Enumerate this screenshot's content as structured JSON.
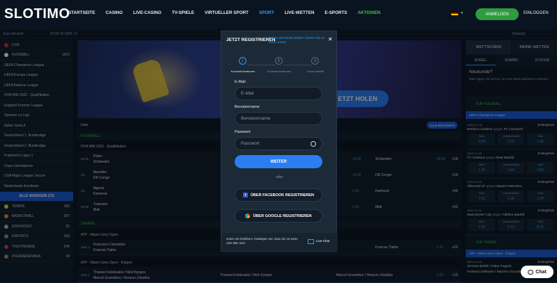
{
  "header": {
    "logo": "SLOTIMO",
    "nav": [
      "STARTSEITE",
      "CASINO",
      "LIVE-CASINO",
      "TV-SPIELE",
      "VIRTUELLER SPORT",
      "SPORT",
      "LIVE-WETTEN",
      "E-SPORTS",
      "AKTIONEN"
    ],
    "active_nav": "SPORT",
    "login": "ANMELDEN",
    "register": "EINLOGGEN"
  },
  "subbar": {
    "odds_view": "Euro-Ansicht",
    "time": "22:06:15 GMT +2",
    "format": "Dezimal"
  },
  "sidebar": {
    "items": [
      {
        "label": "LIVE",
        "count": ""
      },
      {
        "label": "FUSSBALL",
        "count": "1622"
      },
      {
        "label": "UEFA Champions League",
        "count": ""
      },
      {
        "label": "UEFA Europa League",
        "count": ""
      },
      {
        "label": "UEFA Nations League",
        "count": ""
      },
      {
        "label": "FIFA WM 2022 - Qualifikation",
        "count": ""
      },
      {
        "label": "England Premier League",
        "count": ""
      },
      {
        "label": "Spanien La Liga",
        "count": ""
      },
      {
        "label": "Italien Serie A",
        "count": ""
      },
      {
        "label": "Deutschland 1. Bundesliga",
        "count": ""
      },
      {
        "label": "Deutschland 2. Bundesliga",
        "count": ""
      },
      {
        "label": "Frankreich Ligue 1",
        "count": ""
      },
      {
        "label": "Copa Libertadores",
        "count": ""
      },
      {
        "label": "USA Major League Soccer",
        "count": ""
      },
      {
        "label": "Niederlande Eredivisie",
        "count": ""
      }
    ],
    "show_all": "ALLE ANZEIGEN (72)",
    "sports": [
      {
        "label": "TENNIS",
        "count": "165"
      },
      {
        "label": "BASKETBALL",
        "count": "207"
      },
      {
        "label": "EISHOCKEY",
        "count": "62"
      },
      {
        "label": "ESPORTS",
        "count": "159"
      },
      {
        "label": "TISCHTENNIS",
        "count": "245"
      },
      {
        "label": "PFERDERENNEN",
        "count": "42"
      }
    ]
  },
  "main": {
    "hero_button": "ETZT HOLEN",
    "live_label": "Live",
    "all_events": "ALLE 86 EVENTS",
    "football_header": "FUSSBALL",
    "football_league": "FIFA WM 2022 - Qualifikation",
    "football_matches": [
      {
        "min": "88:46",
        "t1": "Polen",
        "t2": "Schweden",
        "mid_name": "",
        "mid_odd": "",
        "odd1": "10.00",
        "right_name": "Schweden",
        "odd2": "50.00",
        "more": "+18"
      },
      {
        "min": "HZ",
        "t1": "Marokko",
        "t2": "DR Congo",
        "mid_name": "",
        "mid_odd": "",
        "odd1": "10.00",
        "right_name": "DR Congo",
        "odd2": "",
        "more": "+19"
      },
      {
        "min": "HZ",
        "t1": "Algeria",
        "t2": "Kamerun",
        "mid_name": "",
        "mid_odd": "2.80",
        "odd1": "",
        "right_name": "Kamerun",
        "odd2": "",
        "more": "+46"
      },
      {
        "min": "45:00",
        "t1": "Tunesien",
        "t2": "Mali",
        "mid_name": "",
        "mid_odd": "2.60",
        "odd1": "",
        "right_name": "Mali",
        "odd2": "",
        "more": "+52"
      }
    ],
    "tennis_header": "TENNIS",
    "tennis_league_1": "ATP - Miami Sony Open",
    "tennis_match_1": {
      "min": "Satz 3",
      "t1": "Francisco Cerundolo",
      "t2": "Frances Tiafoe",
      "right_name": "Frances Tiafoe",
      "odd": "1.25",
      "more": "+20"
    },
    "tennis_league_2": "ATP - Miami Sony Open - Doppel",
    "tennis_match_2": {
      "min": "Satz 1",
      "t1": "Thanasi Kokkinakis / Nick Kyrgios",
      "t2": "Marcel Granollers / Horacio Zeballos",
      "mid_name": "Thanasi Kokkinakis / Nick Kyrgios",
      "right_name": "Marcel Granollers / Horacio Zeballos",
      "odd": "1.65",
      "more": "+10"
    }
  },
  "modal": {
    "title": "JETZT REGISTRIEREN",
    "alt_link": "Haben Sie bereits Daten? Gehen Sie zu Ihrem Konto",
    "steps": [
      {
        "num": "1",
        "label": "Kontoinformationen"
      },
      {
        "num": "2",
        "label": "Kontoinformationen"
      },
      {
        "num": "3",
        "label": "Konto erstellt"
      }
    ],
    "email_label": "E-Mail",
    "email_placeholder": "E-Mail",
    "username_label": "Benutzername",
    "username_placeholder": "Benutzername",
    "password_label": "Passwort",
    "password_placeholder": "Passwort",
    "next": "WEITER",
    "or": "oder",
    "facebook": "ÜBER FACEBOOK REGISTRIEREN",
    "google": "ÜBER GOOGLE REGISTRIEREN",
    "footer_text": "Indem Sie fortfahren, bestätigen Sie, dass Sie 18 Jahre oder älter sind.",
    "live_chat": "Live-Chat"
  },
  "betslip": {
    "tabs": [
      "WETTSCHEIN",
      "MEINE WETTEN"
    ],
    "subtabs": [
      "EINZEL",
      "KOMBO",
      "SYSTEM"
    ],
    "newbie_title": "Neukunde?",
    "newbie_text": "Bitte loggen Sie sich ein, um eine Wette platzieren zu können.",
    "section": "TOP FUSSBALL",
    "league": "UEFA Champions League",
    "matches": [
      {
        "date": "06/04 21:00",
        "status": "Endergebnis",
        "home": "Benfica Lissabon",
        "away": "FC Liverpool",
        "o1": "8.50",
        "ox": "4.70",
        "o2": "1.46"
      },
      {
        "date": "06/04 21:00",
        "status": "Endergebnis",
        "home": "FC Chelsea",
        "away": "Real Madrid",
        "o1": "1.95",
        "ox": "3.40",
        "o2": "3.50"
      },
      {
        "date": "06/04 21:00",
        "status": "Endergebnis",
        "home": "Villarreal CF",
        "away": "Bayern München",
        "o1": "7.50",
        "ox": "5.20",
        "o2": "1.40"
      },
      {
        "date": "06/04 21:00",
        "status": "Endergebnis",
        "home": "Manchester City",
        "away": "Atlético Madrid",
        "o1": "1.36",
        "ox": "5.10",
        "o2": "8.25"
      }
    ],
    "labels": {
      "home": "Heim",
      "draw": "Unentschieden",
      "away": "Gast",
      "vs": "gegen"
    },
    "tennis_section": "TOP TENNIS",
    "tennis_league": "ATP - Miami Sony Open - Doppel",
    "tennis_date": "06/04 21:00",
    "tennis_status": "Endergebnis",
    "tennis_p1": "Simone Bolelli / Fabio Fognini",
    "tennis_p2": "Federico Delbonis / Máximo González"
  },
  "chat_button": "Chat",
  "colors": {
    "accent": "#2aa0ff",
    "primary_button": "#2b7ef2",
    "login_button": "#2e9b3f",
    "live_green": "#3cc64a"
  }
}
